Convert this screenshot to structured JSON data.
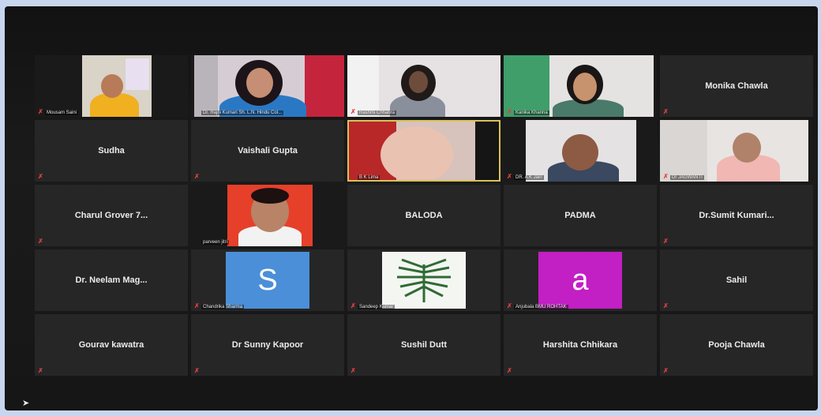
{
  "participants": [
    {
      "name": "Mousam Saini"
    },
    {
      "name": "Dr. Rajni Kumari Sh. L.N. Hindu Col..."
    },
    {
      "name": "Rashmi Chhabra"
    },
    {
      "name": "Kanika Khanna"
    },
    {
      "name": "Monika Chawla"
    },
    {
      "name": "Sudha"
    },
    {
      "name": "Vaishali Gupta"
    },
    {
      "name": "B K Lima"
    },
    {
      "name": "DR. A K Jain"
    },
    {
      "name": "Dr JAGWANTI"
    },
    {
      "name": "Charul Grover 7..."
    },
    {
      "name": "parveen jitri"
    },
    {
      "name": "BALODA"
    },
    {
      "name": "PADMA"
    },
    {
      "name": "Dr.Sumit Kumari..."
    },
    {
      "name": "Dr. Neelam Mag..."
    },
    {
      "name": "Chandrika Sharma",
      "avatar_letter": "S"
    },
    {
      "name": "Sandeep Kumar"
    },
    {
      "name": "Anjubala BMU ROHTAK",
      "avatar_letter": "a"
    },
    {
      "name": "Sahil"
    },
    {
      "name": "Gourav kawatra"
    },
    {
      "name": "Dr Sunny Kapoor"
    },
    {
      "name": "Sushil Dutt"
    },
    {
      "name": "Harshita Chhikara"
    },
    {
      "name": "Pooja Chawla"
    }
  ],
  "colors": {
    "tile_bg": "#262626",
    "active_speaker_border": "#d8c25a",
    "muted_icon": "#e14040",
    "avatar_s_bg": "#4a8fd8",
    "avatar_a_bg": "#c21fc4"
  },
  "icons": {
    "muted": "muted-mic-icon",
    "cursor": "mouse-pointer-icon"
  }
}
